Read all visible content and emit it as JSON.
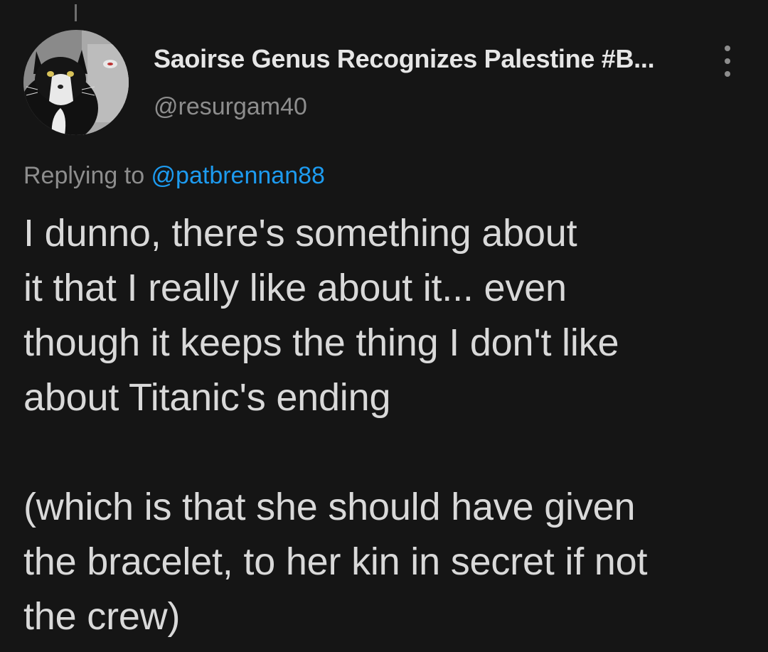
{
  "tweet": {
    "author": {
      "display_name": "Saoirse Genus Recognizes Palestine #B...",
      "handle": "@resurgam40",
      "avatar_icon": "cat-avatar-icon"
    },
    "more_icon": "more-vertical-icon",
    "replying_to": {
      "prefix": "Replying to ",
      "mention": "@patbrennan88"
    },
    "body": {
      "line1": "I dunno, there's something about",
      "line2": "it that I really like about it... even",
      "line3": "though it keeps the thing I don't like",
      "line4": "about Titanic's ending",
      "line5": "(which is that she should have given",
      "line6": "the bracelet, to her kin in secret if not",
      "line7": "the crew)"
    }
  },
  "colors": {
    "background": "#151515",
    "text": "#d9d9d9",
    "muted": "#8d8d8d",
    "link": "#1d9bf0"
  }
}
